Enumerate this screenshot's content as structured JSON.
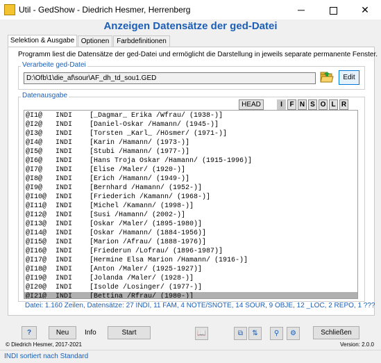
{
  "window": {
    "title": "Util - GedShow  -  Diedrich Hesmer, Herrenberg",
    "min_label": "─",
    "close_label": "✕"
  },
  "heading": "Anzeigen Datensätze der ged-Datei",
  "tabs": [
    {
      "label": "Selektion & Ausgabe"
    },
    {
      "label": "Optionen"
    },
    {
      "label": "Farbdefinitionen"
    }
  ],
  "description": "Programm liest die Datensätze der ged-Datei und ermöglicht die Darstellung in jeweils separate permanente Fenster.",
  "file_group": {
    "label": "Verarbeite ged-Datei",
    "path": "D:\\Ofb\\1\\die_af\\sour\\AF_dh_td_sou1.GED",
    "edit_label": "Edit"
  },
  "output_group": {
    "label": "Datenausgabe",
    "head_label": "HEAD",
    "letters": [
      "I",
      "F",
      "N",
      "S",
      "O",
      "L",
      "R"
    ]
  },
  "records": [
    {
      "id": "@I1@",
      "type": "INDI",
      "name": "[_Dagmar_ Erika /Wfrau/ (1938-)]"
    },
    {
      "id": "@I2@",
      "type": "INDI",
      "name": "[Daniel-Oskar /Hamann/ (1945-)]"
    },
    {
      "id": "@I3@",
      "type": "INDI",
      "name": "[Torsten _Karl_ /Hösmer/ (1971-)]"
    },
    {
      "id": "@I4@",
      "type": "INDI",
      "name": "[Karin /Hamann/ (1973-)]"
    },
    {
      "id": "@I5@",
      "type": "INDI",
      "name": "[Stubi /Hamann/ (1977-)]"
    },
    {
      "id": "@I6@",
      "type": "INDI",
      "name": "[Hans Troja Oskar /Hamann/ (1915-1996)]"
    },
    {
      "id": "@I7@",
      "type": "INDI",
      "name": "[Elise /Maler/ (1920-)]"
    },
    {
      "id": "@I8@",
      "type": "INDI",
      "name": "[Erich /Hamann/ (1949-)]"
    },
    {
      "id": "@I9@",
      "type": "INDI",
      "name": "[Bernhard /Hamann/ (1952-)]"
    },
    {
      "id": "@I10@",
      "type": "INDI",
      "name": "[Friederich /Kamann/ (1968-)]"
    },
    {
      "id": "@I11@",
      "type": "INDI",
      "name": "[Michel /Kamann/ (1998-)]"
    },
    {
      "id": "@I12@",
      "type": "INDI",
      "name": "[Susi /Hamann/ (2002-)]"
    },
    {
      "id": "@I13@",
      "type": "INDI",
      "name": "[Oskar /Maler/ (1895-1980)]"
    },
    {
      "id": "@I14@",
      "type": "INDI",
      "name": "[Oskar /Hamann/ (1884-1956)]"
    },
    {
      "id": "@I15@",
      "type": "INDI",
      "name": "[Marion /Afrau/ (1888-1976)]"
    },
    {
      "id": "@I16@",
      "type": "INDI",
      "name": "[Friederun /Lofrau/ (1896-1987)]"
    },
    {
      "id": "@I17@",
      "type": "INDI",
      "name": "[Hermine Elsa Marion /Hamann/ (1916-)]"
    },
    {
      "id": "@I18@",
      "type": "INDI",
      "name": "[Anton /Maler/ (1925-1927)]"
    },
    {
      "id": "@I19@",
      "type": "INDI",
      "name": "[Jolanda /Maler/ (1928-)]"
    },
    {
      "id": "@I20@",
      "type": "INDI",
      "name": "[Isolde /Losinger/ (1977-)]"
    },
    {
      "id": "@I21@",
      "type": "INDI",
      "name": "[Bettina /Rfrau/ (1980-)]"
    }
  ],
  "stats": "Datei: 1.160 Zeilen, Datensätze: 27 INDI, 11 FAM, 4 NOTE/SNOTE, 14 SOUR, 9 OBJE, 12 _LOC, 2 REPO, 1 ???",
  "bottom": {
    "help_label": "?",
    "new_label": "Neu",
    "info_label": "Info",
    "start_label": "Start",
    "close_label": "Schließen"
  },
  "footer": {
    "copyright": "© Diedrich Hesmer, 2017-2021",
    "version": "Version: 2.0.0"
  },
  "status": "INDI sortiert nach Standard",
  "colors": {
    "accent": "#1b5fb6",
    "selected_row": "#b0b0b0"
  }
}
